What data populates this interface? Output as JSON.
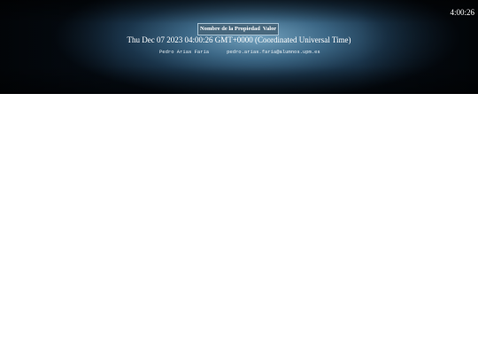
{
  "clock": "4:00:26",
  "table": {
    "header_name": "Nombre de la Propiedad",
    "header_value": "Valor"
  },
  "date_text": "Thu Dec 07 2023 04:00:26 GMT+0000 (Coordinated Universal Time)",
  "author": {
    "name": "Pedro Arias Faria",
    "email": "pedro.arias.faria@alumnos.upm.es"
  }
}
